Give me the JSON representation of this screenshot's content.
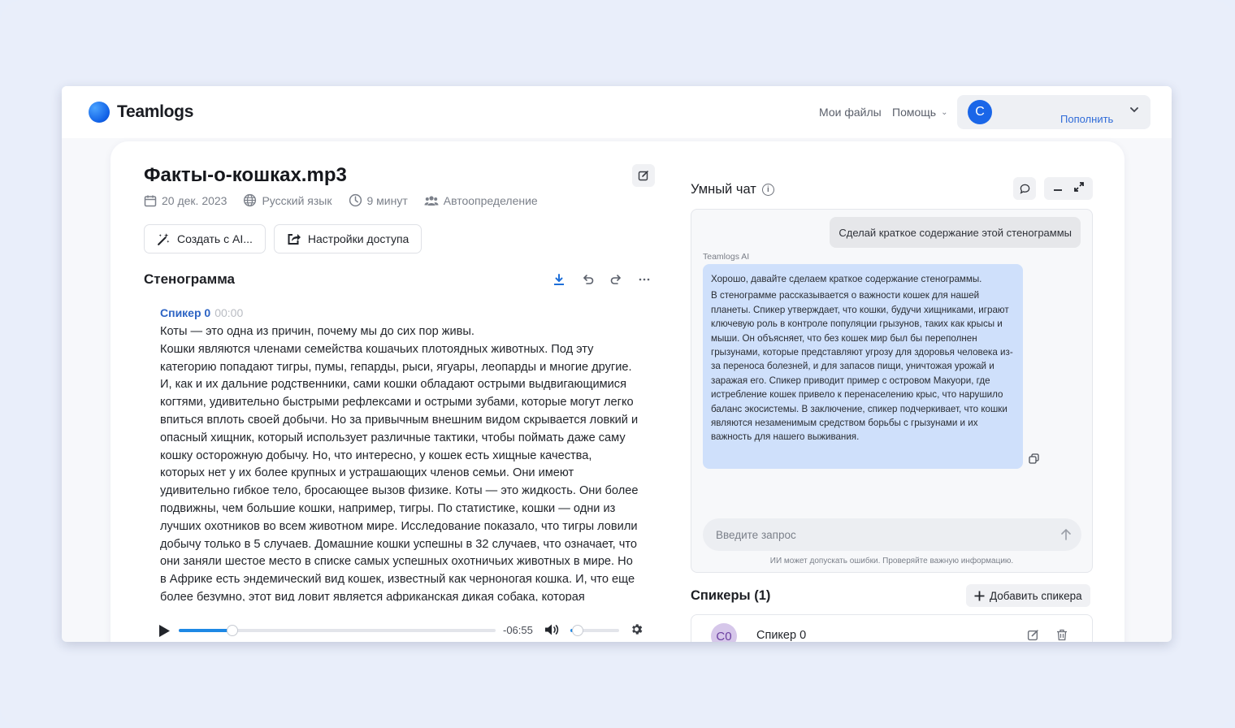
{
  "header": {
    "brand": "Teamlogs",
    "nav_files": "Мои файлы",
    "nav_help": "Помощь",
    "avatar_letter": "С",
    "topup_label": "Пополнить"
  },
  "file": {
    "title": "Факты-о-кошках.mp3",
    "date": "20 дек. 2023",
    "language": "Русский язык",
    "duration": "9 минут",
    "speakers_mode": "Автоопределение"
  },
  "actions": {
    "create_ai": "Создать с AI...",
    "access_settings": "Настройки доступа"
  },
  "transcript": {
    "section_title": "Стенограмма",
    "speaker_name": "Спикер 0",
    "speaker_time": "00:00",
    "text_line1": "Коты — это одна из причин, почему мы до сих пор живы.",
    "text_body": "Кошки являются членами семейства кошачьих плотоядных животных. Под эту категорию попадают тигры, пумы, гепарды, рыси, ягуары, леопарды и многие другие. И, как и их дальние родственники, сами кошки обладают острыми выдвигающимися когтями, удивительно быстрыми рефлексами и острыми зубами, которые могут легко впиться вплоть своей добычи. Но за привычным внешним видом скрывается ловкий и опасный хищник, который использует различные тактики, чтобы поймать даже саму кошку осторожную добычу. Но, что интересно, у кошек есть хищные качества, которых нет у их более крупных и устрашающих членов семьи. Они имеют удивительно гибкое тело, бросающее вызов физике. Коты — это жидкость. Они более подвижны, чем большие кошки, например, тигры. По статистике, кошки — одни из лучших охотников во всем животном мире. Исследование показало, что тигры ловили добычу только в 5 случаев. Домашние кошки успешны в 32 случаев, что означает, что они заняли шестое место в списке самых успешных охотничьих животных в мире. Но в Африке есть эндемический вид кошек, известный как черноногая кошка. И, что еще более безумно, этот вид ловит является африканская дикая собака, которая занимает первое место в"
  },
  "player": {
    "remaining": "-06:55",
    "progress": 0.17,
    "volume": 0.15
  },
  "chat": {
    "title": "Умный чат",
    "user_message": "Сделай краткое содержание этой стенограммы",
    "ai_label": "Teamlogs AI",
    "ai_intro": "Хорошо, давайте сделаем краткое содержание стенограммы.",
    "ai_body": "В стенограмме рассказывается о важности кошек для нашей планеты. Спикер утверждает, что кошки, будучи хищниками, играют ключевую роль в контроле популяции грызунов, таких как крысы и мыши. Он объясняет, что без кошек мир был бы переполнен грызунами, которые представляют угрозу для здоровья человека из-за переноса болезней, и для запасов пищи, уничтожая урожай и заражая его. Спикер приводит пример с островом Макуори, где истребление кошек привело к перенаселению крыс, что нарушило баланс экосистемы. В заключение, спикер подчеркивает, что кошки являются незаменимым средством борьбы с грызунами и их важность для нашего выживания.",
    "input_placeholder": "Введите запрос",
    "disclaimer": "ИИ может допускать ошибки. Проверяйте важную информацию."
  },
  "speakers": {
    "title": "Спикеры (1)",
    "add_label": "Добавить спикера",
    "items": [
      {
        "initials": "С0",
        "name": "Спикер 0"
      }
    ]
  },
  "colors": {
    "accent": "#1e88e5",
    "ai_bubble": "#cfe0fb",
    "speaker_name": "#2d64c4",
    "brand_blue": "#1a66e8"
  }
}
